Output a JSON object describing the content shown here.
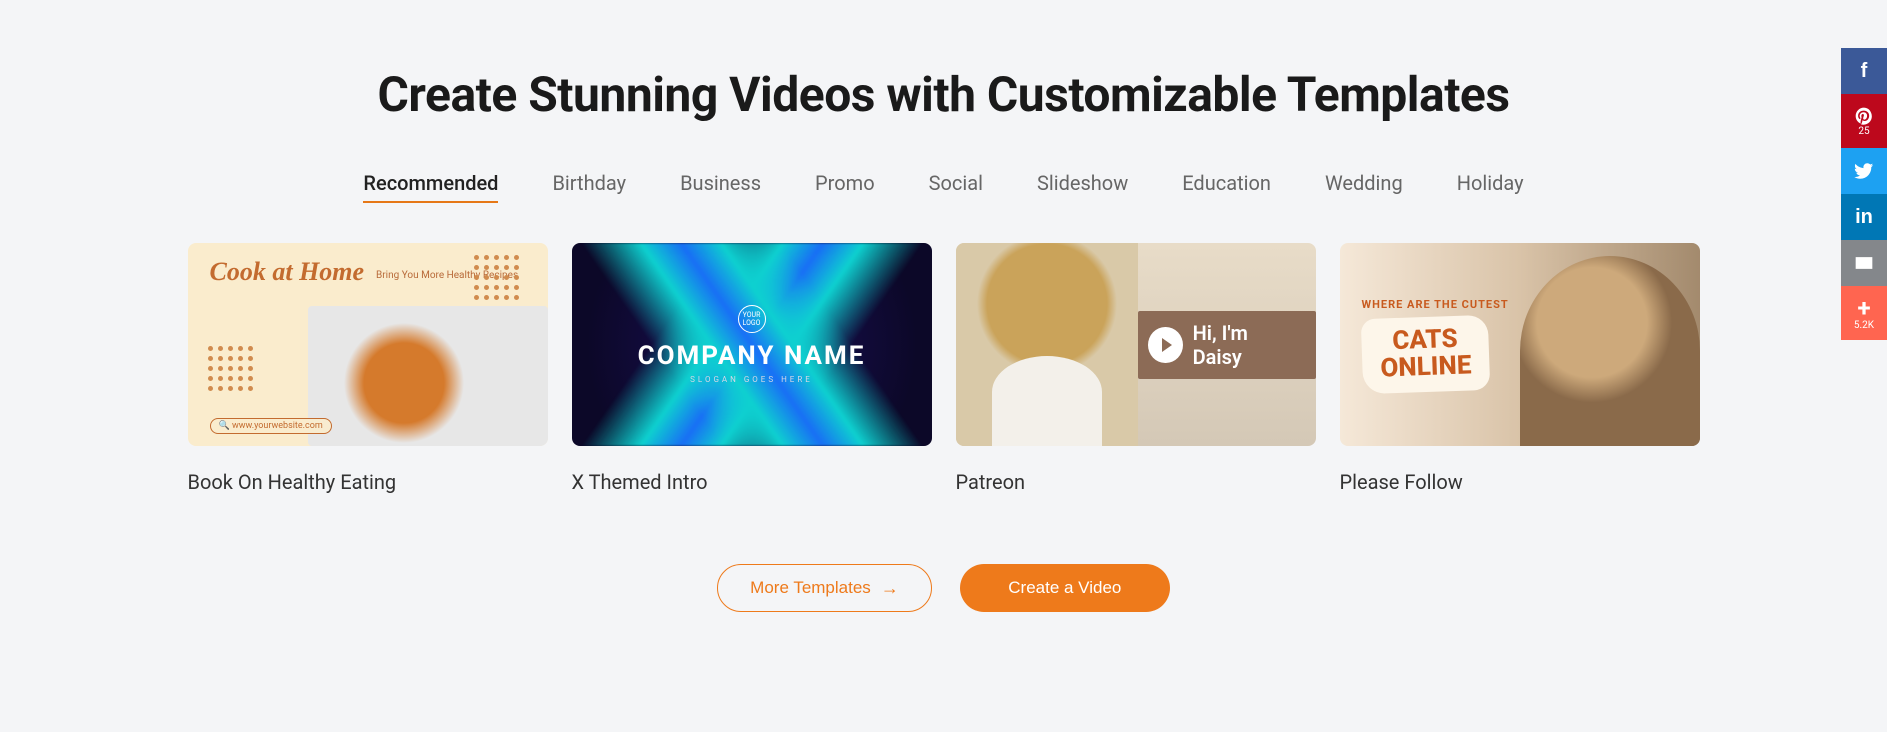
{
  "title": "Create Stunning Videos with Customizable Templates",
  "tabs": [
    {
      "label": "Recommended",
      "active": true
    },
    {
      "label": "Birthday"
    },
    {
      "label": "Business"
    },
    {
      "label": "Promo"
    },
    {
      "label": "Social"
    },
    {
      "label": "Slideshow"
    },
    {
      "label": "Education"
    },
    {
      "label": "Wedding"
    },
    {
      "label": "Holiday"
    }
  ],
  "cards": [
    {
      "title": "Book On Healthy Eating",
      "thumb": {
        "headline": "Cook at Home",
        "sub": "Bring You More Healthy Recipes",
        "url": "www.yourwebsite.com"
      }
    },
    {
      "title": "X Themed Intro",
      "thumb": {
        "logo": "YOUR LOGO",
        "company": "COMPANY NAME",
        "slogan": "SLOGAN GOES HERE"
      }
    },
    {
      "title": "Patreon",
      "thumb": {
        "greeting": "Hi, I'm Daisy"
      }
    },
    {
      "title": "Please Follow",
      "thumb": {
        "where": "WHERE ARE THE CUTEST",
        "cats_line1": "CATS",
        "cats_line2": "ONLINE"
      }
    }
  ],
  "buttons": {
    "more_templates": "More Templates",
    "create_video": "Create a Video"
  },
  "social": {
    "pinterest_count": "25",
    "addthis_count": "5.2K"
  }
}
